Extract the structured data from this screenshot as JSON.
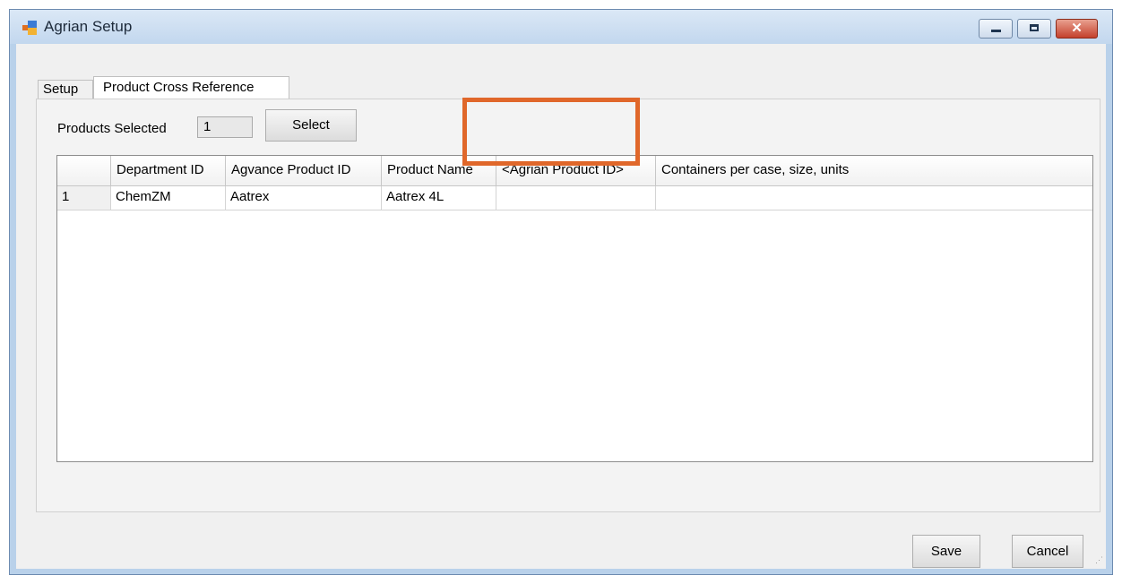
{
  "window": {
    "title": "Agrian Setup"
  },
  "tabs": [
    {
      "label": "Setup"
    },
    {
      "label": "Product Cross Reference",
      "active": true
    }
  ],
  "products_selected": {
    "label": "Products Selected",
    "value": "1"
  },
  "select_button": "Select",
  "grid": {
    "columns": [
      "Department ID",
      "Agvance Product ID",
      "Product Name",
      "<Agrian Product ID>",
      "Containers per case, size, units"
    ],
    "rows": [
      {
        "row_header": "1",
        "cells": [
          "ChemZM",
          "Aatrex",
          "Aatrex 4L",
          "",
          ""
        ]
      }
    ]
  },
  "buttons": {
    "save": "Save",
    "cancel": "Cancel"
  },
  "colors": {
    "highlight": "#e0672a",
    "title_bar": "#c2d7ee",
    "close_button": "#c4412d"
  }
}
